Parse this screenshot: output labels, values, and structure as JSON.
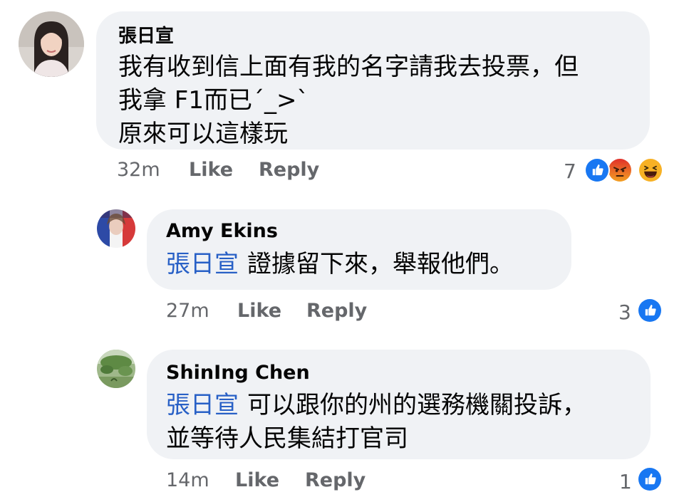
{
  "comments": [
    {
      "author": "張日宣",
      "lines": [
        "我有收到信上面有我的名字請我去投票，但",
        "我拿 F1而已´_>`",
        "原來可以這樣玩"
      ],
      "time": "32m",
      "like_label": "Like",
      "reply_label": "Reply",
      "reaction_count": "7",
      "reactions": [
        "like-icon",
        "angry-icon",
        "haha-icon"
      ]
    },
    {
      "author": "Amy Ekins",
      "mention": "張日宣",
      "lines": [
        "證據留下來，舉報他們。"
      ],
      "time": "27m",
      "like_label": "Like",
      "reply_label": "Reply",
      "reaction_count": "3",
      "reactions": [
        "like-icon"
      ]
    },
    {
      "author": "ShinIng Chen",
      "mention": "張日宣",
      "lines": [
        "可以跟你的州的選務機關投訴，",
        "並等待人民集結打官司"
      ],
      "time": "14m",
      "like_label": "Like",
      "reply_label": "Reply",
      "reaction_count": "1",
      "reactions": [
        "like-icon"
      ]
    }
  ],
  "colors": {
    "bubble": "#f0f2f5",
    "mention": "#2860c6",
    "meta": "#65676b",
    "like": "#1877f2",
    "angry": "#e9710f",
    "haha": "#f7b125"
  }
}
